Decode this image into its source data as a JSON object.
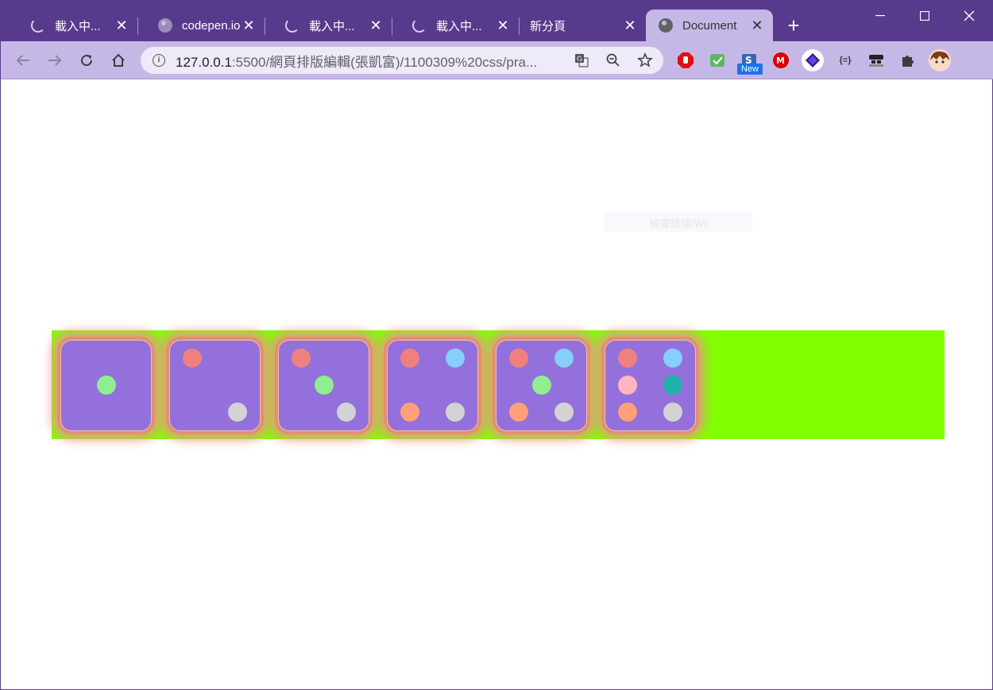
{
  "browser": {
    "tabs": [
      {
        "title": "載入中...",
        "icon": "loading-spinner"
      },
      {
        "title": "codepen.io",
        "icon": "globe-icon"
      },
      {
        "title": "載入中...",
        "icon": "loading-spinner"
      },
      {
        "title": "載入中...",
        "icon": "loading-spinner"
      },
      {
        "title": "新分頁",
        "icon": ""
      },
      {
        "title": "Document",
        "icon": "globe-icon",
        "active": true
      }
    ],
    "new_tab": "+",
    "controls": {
      "minimize": "—",
      "maximize": "☐",
      "close": "✕"
    },
    "close_glyph": "✕",
    "url_host": "127.0.0.1",
    "url_rest": ":5500/網頁排版編輯(張凱富)/1100309%20css/pra...",
    "extensions": [
      "adblock",
      "check",
      "new-badge",
      "mega",
      "layers",
      "json",
      "incognito",
      "puzzle",
      "avatar"
    ],
    "new_badge_label": "New",
    "json_label": "{≡}"
  },
  "page": {
    "ghost_tooltip": "檢查錯誤(W)",
    "colors": {
      "stage": "#80ff00",
      "die_face": "#9370db",
      "die_glow": "#e89a82",
      "pip_red": "#f08080",
      "pip_blue": "#87cefa",
      "pip_green": "#90ee90",
      "pip_orange": "#ffa07a",
      "pip_gray": "#d3d3d3",
      "pip_pink": "#ffb6c1",
      "pip_teal": "#20b2aa"
    },
    "dice": [
      {
        "face": 1,
        "pips": [
          "green"
        ]
      },
      {
        "face": 2,
        "pips": [
          "red",
          "gray"
        ]
      },
      {
        "face": 3,
        "pips": [
          "red",
          "green",
          "gray"
        ]
      },
      {
        "face": 4,
        "pips": [
          "red",
          "blue",
          "orange",
          "gray"
        ]
      },
      {
        "face": 5,
        "pips": [
          "red",
          "blue",
          "green",
          "orange",
          "gray"
        ]
      },
      {
        "face": 6,
        "pips": [
          "red",
          "blue",
          "pink",
          "teal",
          "orange",
          "gray"
        ]
      }
    ]
  }
}
